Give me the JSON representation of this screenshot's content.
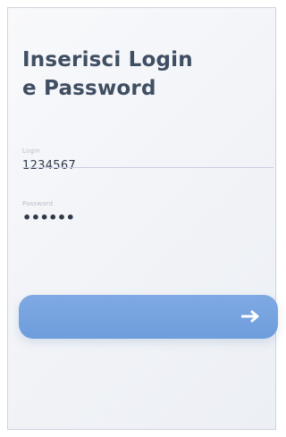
{
  "screen": {
    "title_line_1": "Inserisci Login",
    "title_line_2": "e Password"
  },
  "form": {
    "login_label": "Login",
    "login_value": "1234567",
    "password_label": "Password",
    "password_mask": "••••••"
  },
  "actions": {
    "submit_icon": "right-arrow-icon"
  },
  "colors": {
    "title": "#3f4e62",
    "button": "#75a3df",
    "field_line": "#c9cde4"
  }
}
